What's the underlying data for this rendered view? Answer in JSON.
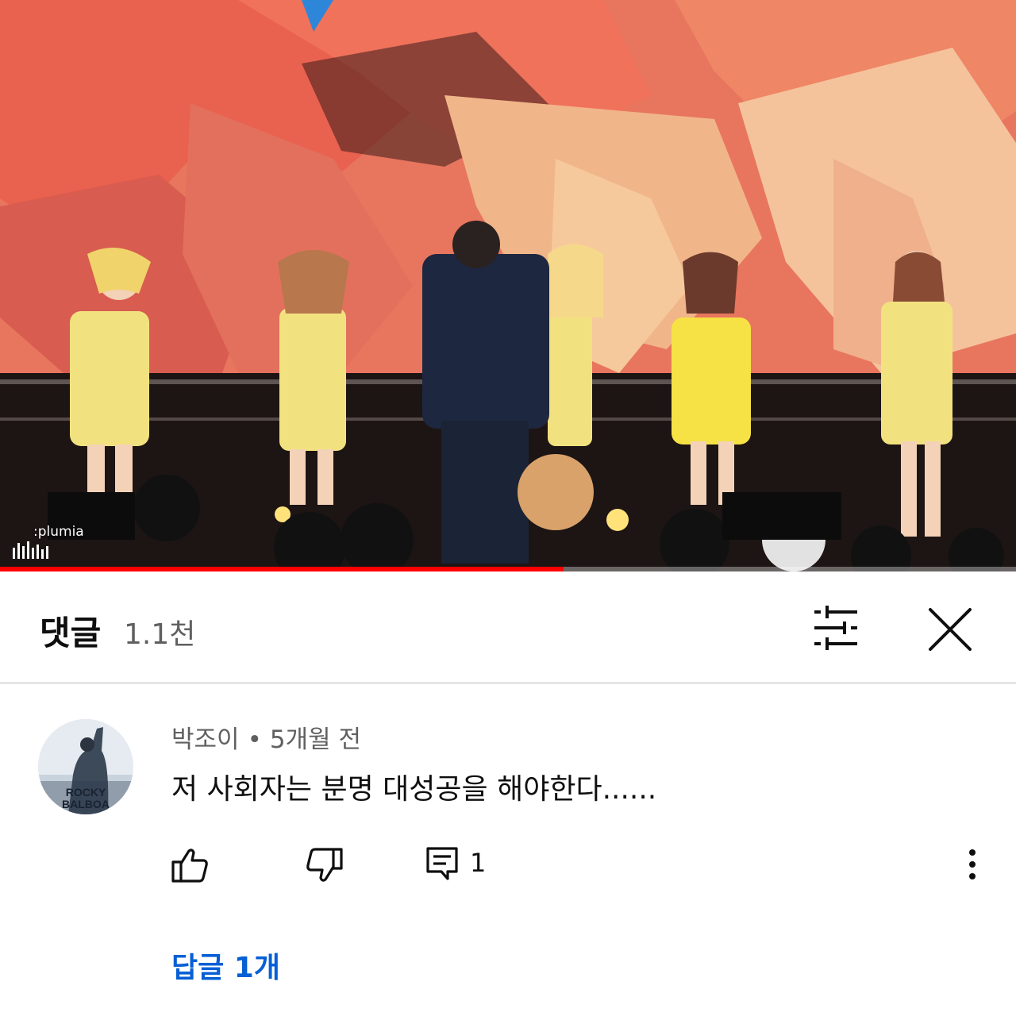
{
  "video": {
    "watermark": ":plumia",
    "progress": 0.555
  },
  "comments_header": {
    "title": "댓글",
    "count": "1.1천",
    "filter_icon": "sort-filter-icon",
    "close_icon": "close-icon"
  },
  "comment": {
    "author": "박조이",
    "separator": "•",
    "time": "5개월 전",
    "text": "저 사회자는 분명 대성공을 해야한다......",
    "avatar_text": [
      "ROCKY",
      "BALBOA"
    ],
    "like_icon": "thumbs-up-icon",
    "dislike_icon": "thumbs-down-icon",
    "reply_icon": "comment-reply-icon",
    "reply_count": "1",
    "more_icon": "more-vertical-icon",
    "replies_link": "답글 1개"
  },
  "colors": {
    "accent_link": "#065fd4",
    "progress": "#ff0000",
    "secondary_text": "#606060"
  }
}
